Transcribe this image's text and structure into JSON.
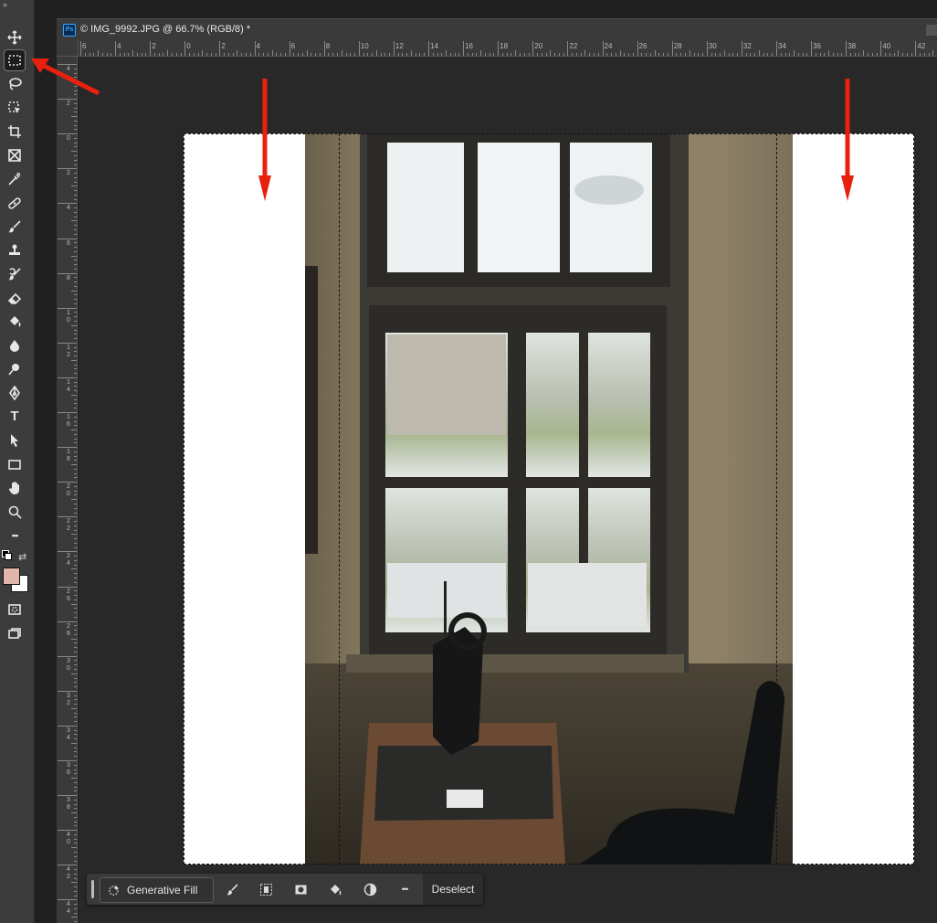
{
  "document": {
    "app_badge": "Ps",
    "tab_title": "© IMG_9992.JPG @ 66.7% (RGB/8) *"
  },
  "toolbar": {
    "collapse_glyph": "»",
    "tools": [
      {
        "name": "move-tool",
        "icon": "move-icon"
      },
      {
        "name": "rectangular-marquee-tool",
        "icon": "marquee-icon",
        "active": true
      },
      {
        "name": "lasso-tool",
        "icon": "lasso-icon"
      },
      {
        "name": "object-selection-tool",
        "icon": "object-selection-icon"
      },
      {
        "name": "crop-tool",
        "icon": "crop-icon"
      },
      {
        "name": "frame-tool",
        "icon": "frame-icon"
      },
      {
        "name": "eyedropper-tool",
        "icon": "eyedropper-icon"
      },
      {
        "name": "spot-healing-tool",
        "icon": "bandage-icon"
      },
      {
        "name": "brush-tool",
        "icon": "brush-icon"
      },
      {
        "name": "clone-stamp-tool",
        "icon": "stamp-icon"
      },
      {
        "name": "history-brush-tool",
        "icon": "history-brush-icon"
      },
      {
        "name": "eraser-tool",
        "icon": "eraser-icon"
      },
      {
        "name": "paint-bucket-tool",
        "icon": "bucket-icon"
      },
      {
        "name": "blur-tool",
        "icon": "drop-icon"
      },
      {
        "name": "dodge-tool",
        "icon": "dodge-icon"
      },
      {
        "name": "pen-tool",
        "icon": "pen-icon"
      },
      {
        "name": "type-tool",
        "icon": "type-icon",
        "glyph": "T"
      },
      {
        "name": "path-selection-tool",
        "icon": "arrow-icon"
      },
      {
        "name": "rectangle-tool",
        "icon": "rectangle-icon"
      },
      {
        "name": "hand-tool",
        "icon": "hand-icon"
      },
      {
        "name": "zoom-tool",
        "icon": "zoom-icon"
      },
      {
        "name": "edit-toolbar",
        "icon": "more-icon",
        "glyph": "•••"
      }
    ],
    "foreground_color": "#e0b5aa",
    "background_color": "#ffffff"
  },
  "rulers": {
    "top_labels": [
      "6",
      "4",
      "2",
      "0",
      "2",
      "4",
      "6",
      "8",
      "10",
      "12",
      "14",
      "16",
      "18",
      "20",
      "22",
      "24",
      "26",
      "28",
      "30",
      "32",
      "34",
      "36",
      "38",
      "40",
      "42"
    ],
    "left_labels": [
      "4",
      "2",
      "0",
      "2",
      "4",
      "6",
      "8",
      "1\n0",
      "1\n2",
      "1\n4",
      "1\n6",
      "1\n8",
      "2\n0",
      "2\n2",
      "2\n4",
      "2\n6",
      "2\n8",
      "3\n0",
      "3\n2",
      "3\n4",
      "3\n6",
      "3\n8",
      "4\n0",
      "4\n2",
      "4\n4"
    ]
  },
  "taskbar": {
    "generative_fill_label": "Generative Fill",
    "buttons": [
      "brush-icon",
      "select-subject-icon",
      "mask-icon",
      "fill-icon",
      "adjustment-icon",
      "more-icon"
    ],
    "more_glyph": "•••",
    "deselect_label": "Deselect"
  },
  "colors": {
    "annotation_red": "#e8210f",
    "ps_blue": "#31a8ff"
  }
}
